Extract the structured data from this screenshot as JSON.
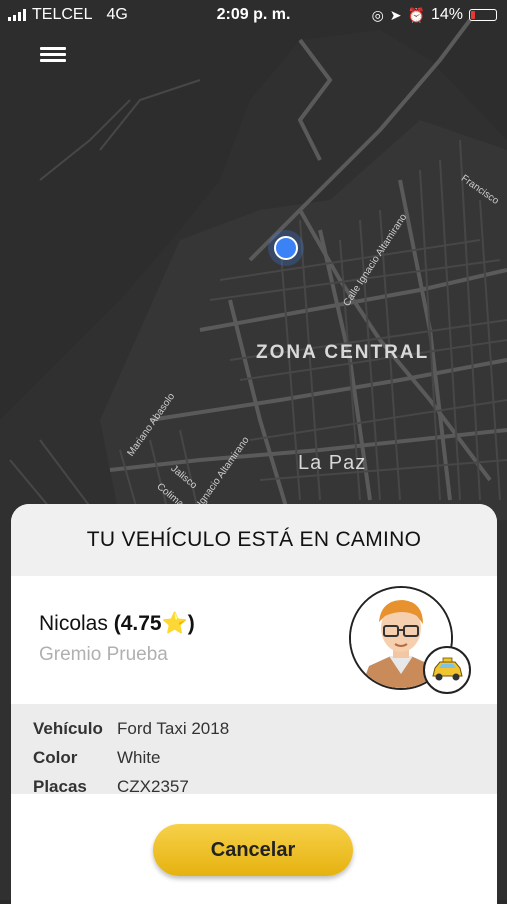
{
  "status_bar": {
    "carrier": "TELCEL",
    "network": "4G",
    "time": "2:09 p. m.",
    "battery": "14%"
  },
  "map": {
    "labels": {
      "zone": "ZONA CENTRAL",
      "city": "La Paz"
    },
    "streets": [
      "Calle Ignacio Altamirano",
      "Francisco",
      "Mariano Abasolo",
      "Ignacio Altamirano",
      "Jalisco",
      "Colima"
    ]
  },
  "sheet": {
    "title": "TU VEHÍCULO ESTÁ EN CAMINO",
    "driver": {
      "name": "Nicolas",
      "rating": "(4.75⭐)",
      "organization": "Gremio Prueba"
    },
    "vehicle": {
      "label": "Vehículo",
      "value": "Ford Taxi 2018"
    },
    "color": {
      "label": "Color",
      "value": "White"
    },
    "plates": {
      "label": "Placas",
      "value": "CZX2357"
    },
    "cancel_label": "Cancelar"
  },
  "icons": {
    "menu": "hamburger-menu-icon",
    "location": "current-location-icon",
    "taxi": "taxi-icon",
    "avatar": "driver-avatar"
  },
  "colors": {
    "accent": "#f2c530",
    "location": "#3b82f6",
    "battery_low": "#e53935"
  }
}
